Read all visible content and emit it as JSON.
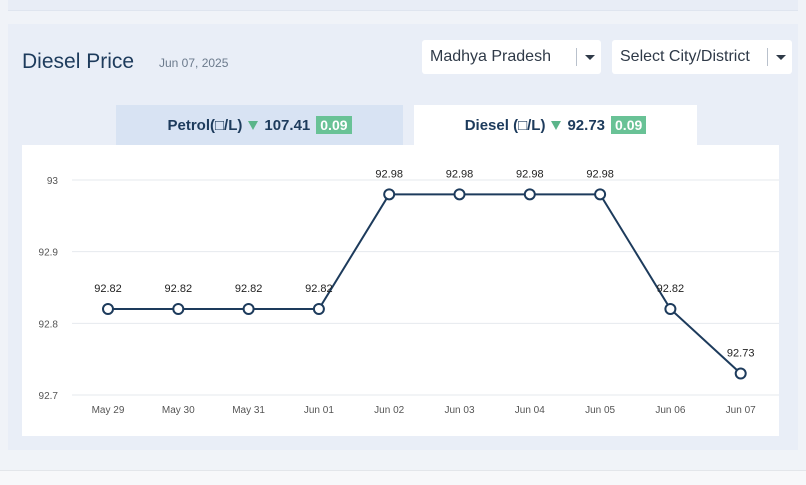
{
  "header": {
    "title": "Diesel Price",
    "date": "Jun 07, 2025"
  },
  "filters": {
    "state": "Madhya Pradesh",
    "city": "Select City/District"
  },
  "tabs": [
    {
      "label": "Petrol(□/L)",
      "value": "107.41",
      "change": "0.09",
      "direction": "down",
      "active": false
    },
    {
      "label": "Diesel (□/L)",
      "value": "92.73",
      "change": "0.09",
      "direction": "down",
      "active": true
    }
  ],
  "chart_data": {
    "type": "line",
    "title": "",
    "xlabel": "",
    "ylabel": "",
    "categories": [
      "May 29",
      "May 30",
      "May 31",
      "Jun 01",
      "Jun 02",
      "Jun 03",
      "Jun 04",
      "Jun 05",
      "Jun 06",
      "Jun 07"
    ],
    "series": [
      {
        "values": [
          92.82,
          92.82,
          92.82,
          92.82,
          92.98,
          92.98,
          92.98,
          92.98,
          92.82,
          92.73
        ]
      }
    ],
    "y_ticks": [
      "92.7",
      "92.8",
      "92.9",
      "93"
    ],
    "ylim": [
      92.7,
      93
    ],
    "grid": true,
    "line_color": "#1d3b5c",
    "marker_fill": "#ffffff",
    "legend": "none"
  }
}
